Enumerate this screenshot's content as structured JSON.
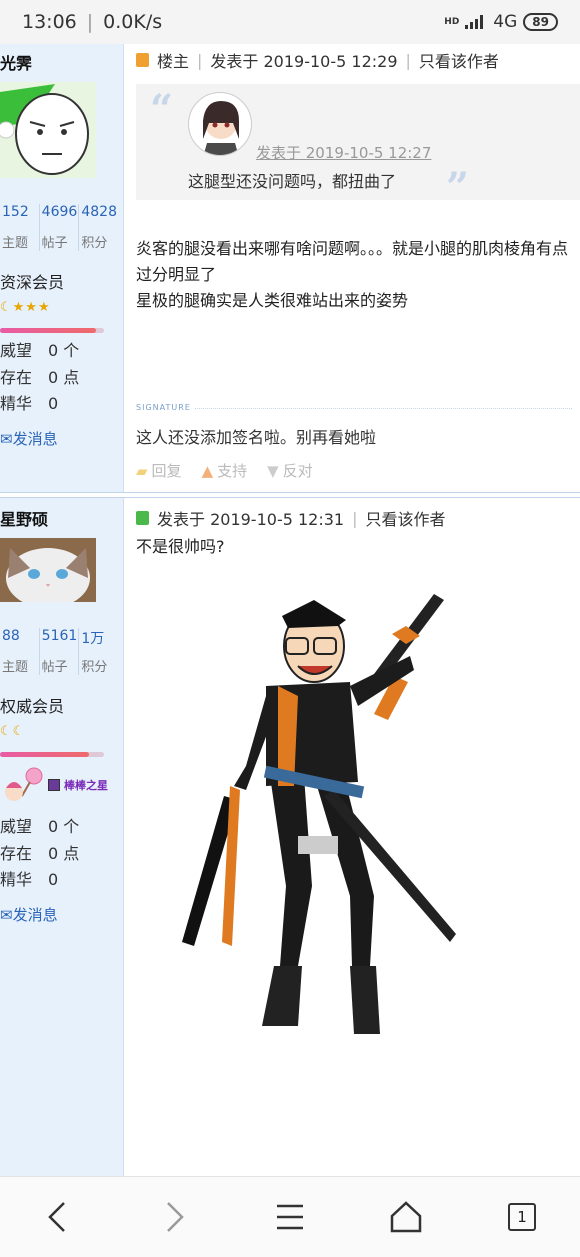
{
  "status": {
    "time": "13:06",
    "speed": "0.0K/s",
    "hd": "HD",
    "network": "4G",
    "battery": "89"
  },
  "posts": [
    {
      "username": "光霁",
      "stats": [
        {
          "num": "152",
          "label": "主题"
        },
        {
          "num": "4696",
          "label": "帖子"
        },
        {
          "num": "4828",
          "label": "积分"
        }
      ],
      "rank": "资深会员",
      "stars": "☾★★★",
      "level_fill": 0.92,
      "info": [
        "威望　0 个",
        "存在　0 点",
        "精华　0"
      ],
      "message_link": "发消息",
      "header": {
        "role": "楼主",
        "posted": "发表于 2019-10-5 12:29",
        "only_author": "只看该作者"
      },
      "quote": {
        "time": "发表于 2019-10-5 12:27",
        "text": "这腿型还没问题吗，都扭曲了"
      },
      "body": [
        "炎客的腿没看出来哪有啥问题啊。。。就是小腿的肌肉棱角有点过分明显了",
        "星极的腿确实是人类很难站出来的姿势"
      ],
      "signature_label": "SIGNATURE",
      "signature": "这人还没添加签名啦。别再看她啦",
      "actions": {
        "reply": "回复",
        "support": "支持",
        "oppose": "反对"
      }
    },
    {
      "username": "星野硕",
      "stats": [
        {
          "num": "88",
          "label": "主题"
        },
        {
          "num": "5161",
          "label": "帖子"
        },
        {
          "num": "1万",
          "label": "积分"
        }
      ],
      "rank": "权威会员",
      "stars": "☾☾",
      "level_fill": 0.86,
      "medal": "棒棒之星",
      "info": [
        "威望　0 个",
        "存在　0 点",
        "精华　0"
      ],
      "message_link": "发消息",
      "header": {
        "posted": "发表于 2019-10-5 12:31",
        "only_author": "只看该作者"
      },
      "body": [
        "不是很帅吗?"
      ]
    }
  ],
  "nav": {
    "tabs_count": "1"
  }
}
